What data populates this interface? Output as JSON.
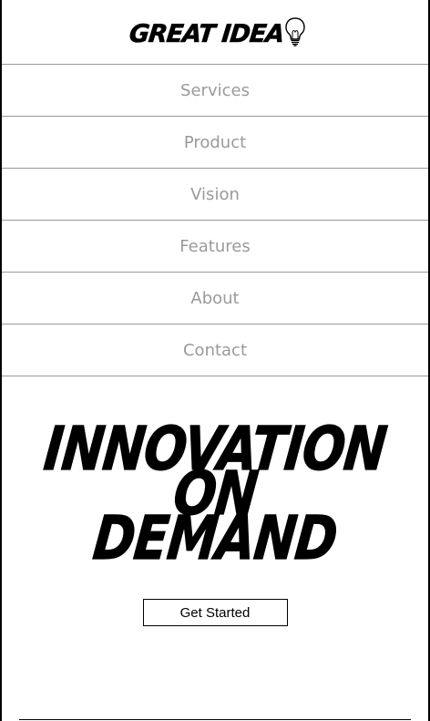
{
  "header": {
    "logo_text": "GREAT IDEA",
    "logo_icon": "lightbulb-icon"
  },
  "nav": {
    "items": [
      {
        "label": "Services"
      },
      {
        "label": "Product"
      },
      {
        "label": "Vision"
      },
      {
        "label": "Features"
      },
      {
        "label": "About"
      },
      {
        "label": "Contact"
      }
    ]
  },
  "hero": {
    "lines": [
      "INNOVATION",
      "ON",
      "DEMAND"
    ],
    "cta_label": "Get Started"
  },
  "colors": {
    "nav_text": "#9a9a9a",
    "divider": "#999999",
    "text": "#000000"
  }
}
